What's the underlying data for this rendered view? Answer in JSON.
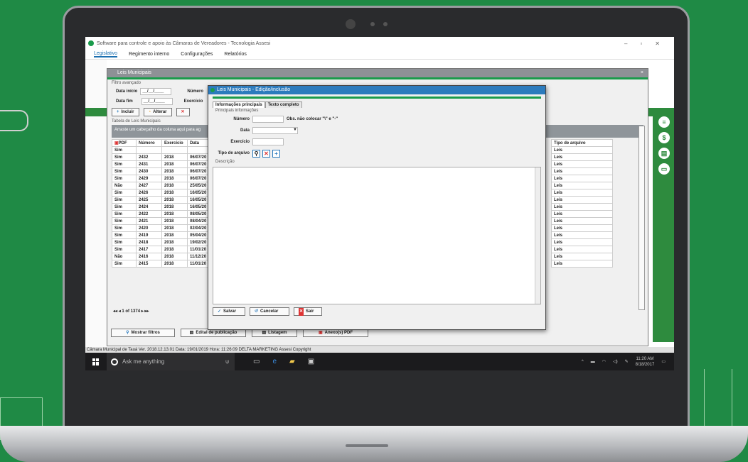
{
  "app": {
    "title": "Software para controle e apoio às Câmaras de Vereadores - Tecnologia Assesi",
    "menu": [
      "Legislativo",
      "Regimento interno",
      "Configurações",
      "Relatórios"
    ]
  },
  "list_window": {
    "title": "Leis Municipais",
    "filter_label": "Filtro avançado",
    "data_inicio_label": "Data início",
    "data_fim_label": "Data fim",
    "numero_label": "Número",
    "exercicio_label": "Exercício",
    "date_placeholder": "__/__/____",
    "btn_incluir": "Incluir",
    "btn_alterar": "Alterar",
    "table_label": "Tabela de Leis Municipais",
    "group_hint": "Arraste um cabeçalho da coluna aqui para ag",
    "columns": [
      "PDF",
      "Número",
      "Exercício",
      "Data",
      "Tipo de arquivo"
    ],
    "rows": [
      [
        "Sim",
        "",
        "",
        "",
        "Leis"
      ],
      [
        "Sim",
        "2432",
        "2018",
        "06/07/20",
        "Leis"
      ],
      [
        "Sim",
        "2431",
        "2018",
        "06/07/20",
        "Leis"
      ],
      [
        "Sim",
        "2430",
        "2018",
        "06/07/20",
        "Leis"
      ],
      [
        "Sim",
        "2429",
        "2018",
        "06/07/20",
        "Leis"
      ],
      [
        "Não",
        "2427",
        "2018",
        "25/05/20",
        "Leis"
      ],
      [
        "Sim",
        "2426",
        "2018",
        "16/05/20",
        "Leis"
      ],
      [
        "Sim",
        "2425",
        "2018",
        "16/05/20",
        "Leis"
      ],
      [
        "Sim",
        "2424",
        "2018",
        "16/05/20",
        "Leis"
      ],
      [
        "Sim",
        "2422",
        "2018",
        "08/05/20",
        "Leis"
      ],
      [
        "Sim",
        "2421",
        "2018",
        "08/04/20",
        "Leis"
      ],
      [
        "Sim",
        "2420",
        "2018",
        "02/04/20",
        "Leis"
      ],
      [
        "Sim",
        "2419",
        "2018",
        "05/04/20",
        "Leis"
      ],
      [
        "Sim",
        "2418",
        "2018",
        "19/02/20",
        "Leis"
      ],
      [
        "Sim",
        "2417",
        "2018",
        "11/01/20",
        "Leis"
      ],
      [
        "Não",
        "2416",
        "2018",
        "11/12/20",
        "Leis"
      ],
      [
        "Sim",
        "2415",
        "2018",
        "11/01/20",
        "Leis"
      ]
    ],
    "pager": "1 of 1374",
    "btn_mostrar_filtros": "Mostrar filtros",
    "btn_edital": "Edital de publicação",
    "btn_listagem": "Listagem",
    "btn_anexos": "Anexo(s) PDF"
  },
  "dialog": {
    "title": "Leis Municipais - Edição/inclusão",
    "tab_main": "Informações principais",
    "tab_text": "Texto completo",
    "section_label": "Principais informações",
    "numero_label": "Número",
    "obs_text": "Obs. não colocar \"\\\" e \"-\"",
    "data_label": "Data",
    "exercicio_label": "Exercício",
    "tipo_label": "Tipo de arquivo",
    "descricao_label": "Descrição",
    "btn_salvar": "Salvar",
    "btn_cancelar": "Cancelar",
    "btn_sair": "Sair"
  },
  "status_bar": "Câmara Municipal de Tauá                                        Ver. 2018.12.13.01   Data: 19/01/2019   Hora: 11:26:09      DELTA MARKETING    Assesi Copyright",
  "taskbar": {
    "search_placeholder": "Ask me anything",
    "time": "11:20 AM",
    "date": "8/18/2017"
  },
  "colors": {
    "brand_green": "#1f8a45",
    "accent_blue": "#2c7bbd"
  }
}
